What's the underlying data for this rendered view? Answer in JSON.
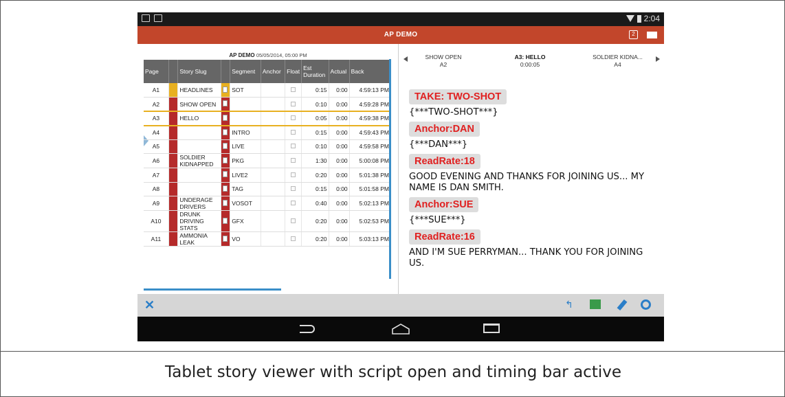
{
  "status_bar": {
    "time": "2:04"
  },
  "app_bar": {
    "title": "AP DEMO",
    "pages_icon_label": "2"
  },
  "rundown": {
    "show_name": "AP DEMO",
    "show_datetime": "05/05/2014, 05:00 PM",
    "columns": [
      "Page",
      "Story Slug",
      "Segment",
      "Anchor",
      "Float",
      "Est Duration",
      "Actual",
      "Back"
    ],
    "rows": [
      {
        "page": "A1",
        "slug": "HEADLINES",
        "segment": "SOT",
        "est": "0:15",
        "actual": "0:00",
        "back": "4:59:13 PM",
        "color": "#e8b020"
      },
      {
        "page": "A2",
        "slug": "SHOW OPEN",
        "segment": "",
        "est": "0:10",
        "actual": "0:00",
        "back": "4:59:28 PM",
        "color": "#b52a2a"
      },
      {
        "page": "A3",
        "slug": "HELLO",
        "segment": "",
        "est": "0:05",
        "actual": "0:00",
        "back": "4:59:38 PM",
        "color": "#b52a2a"
      },
      {
        "page": "A4",
        "slug": "",
        "segment": "INTRO",
        "est": "0:15",
        "actual": "0:00",
        "back": "4:59:43 PM",
        "color": "#b52a2a"
      },
      {
        "page": "A5",
        "slug": "",
        "segment": "LIVE",
        "est": "0:10",
        "actual": "0:00",
        "back": "4:59:58 PM",
        "color": "#b52a2a"
      },
      {
        "page": "A6",
        "slug": "SOLDIER KIDNAPPED",
        "segment": "PKG",
        "est": "1:30",
        "actual": "0:00",
        "back": "5:00:08 PM",
        "color": "#b52a2a"
      },
      {
        "page": "A7",
        "slug": "",
        "segment": "LIVE2",
        "est": "0:20",
        "actual": "0:00",
        "back": "5:01:38 PM",
        "color": "#b52a2a"
      },
      {
        "page": "A8",
        "slug": "",
        "segment": "TAG",
        "est": "0:15",
        "actual": "0:00",
        "back": "5:01:58 PM",
        "color": "#b52a2a"
      },
      {
        "page": "A9",
        "slug": "UNDERAGE DRIVERS",
        "segment": "VOSOT",
        "est": "0:40",
        "actual": "0:00",
        "back": "5:02:13 PM",
        "color": "#b52a2a"
      },
      {
        "page": "A10",
        "slug": "DRUNK DRIVING STATS",
        "segment": "GFX",
        "est": "0:20",
        "actual": "0:00",
        "back": "5:02:53 PM",
        "color": "#b52a2a"
      },
      {
        "page": "A11",
        "slug": "AMMONIA LEAK",
        "segment": "VO",
        "est": "0:20",
        "actual": "0:00",
        "back": "5:03:13 PM",
        "color": "#b52a2a"
      }
    ]
  },
  "story_nav": {
    "prev_slug": "SHOW OPEN",
    "prev_page": "A2",
    "current_title": "A3: HELLO",
    "current_time": "0:00:05",
    "next_slug": "SOLDIER KIDNA...",
    "next_page": "A4"
  },
  "script": {
    "cue1": "TAKE: TWO-SHOT",
    "line1": "{***TWO-SHOT***}",
    "cue2": "Anchor:DAN",
    "line2": "{***DAN***}",
    "cue3": "ReadRate:18",
    "line3": "GOOD EVENING AND THANKS FOR JOINING US... MY NAME IS DAN SMITH.",
    "cue4": "Anchor:SUE",
    "line4": "{***SUE***}",
    "cue5": "ReadRate:16",
    "line5": "AND I'M SUE PERRYMAN... THANK YOU FOR JOINING US."
  },
  "caption": "Tablet story viewer with script open and timing bar active"
}
